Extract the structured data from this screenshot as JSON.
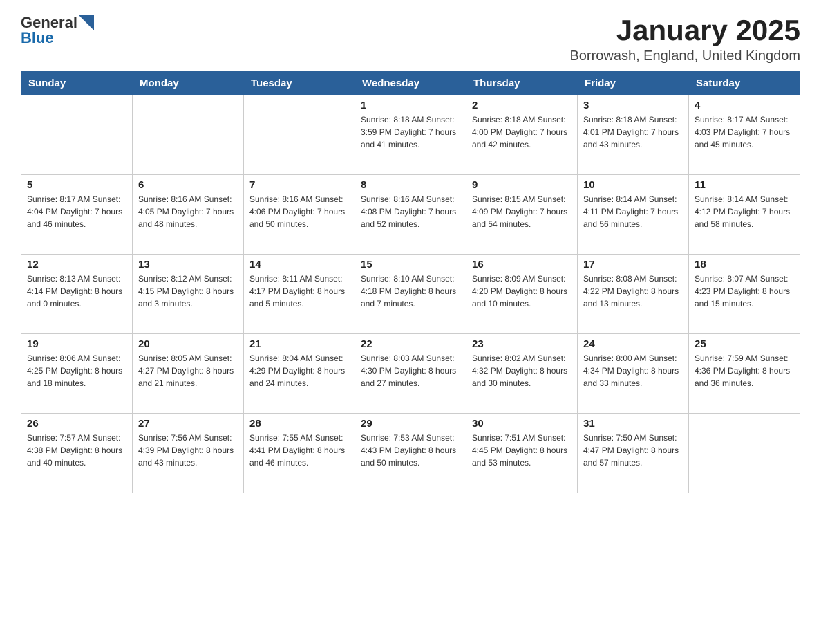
{
  "header": {
    "logo_general": "General",
    "logo_blue": "Blue",
    "title": "January 2025",
    "location": "Borrowash, England, United Kingdom"
  },
  "days_of_week": [
    "Sunday",
    "Monday",
    "Tuesday",
    "Wednesday",
    "Thursday",
    "Friday",
    "Saturday"
  ],
  "weeks": [
    [
      {
        "day": "",
        "info": ""
      },
      {
        "day": "",
        "info": ""
      },
      {
        "day": "",
        "info": ""
      },
      {
        "day": "1",
        "info": "Sunrise: 8:18 AM\nSunset: 3:59 PM\nDaylight: 7 hours\nand 41 minutes."
      },
      {
        "day": "2",
        "info": "Sunrise: 8:18 AM\nSunset: 4:00 PM\nDaylight: 7 hours\nand 42 minutes."
      },
      {
        "day": "3",
        "info": "Sunrise: 8:18 AM\nSunset: 4:01 PM\nDaylight: 7 hours\nand 43 minutes."
      },
      {
        "day": "4",
        "info": "Sunrise: 8:17 AM\nSunset: 4:03 PM\nDaylight: 7 hours\nand 45 minutes."
      }
    ],
    [
      {
        "day": "5",
        "info": "Sunrise: 8:17 AM\nSunset: 4:04 PM\nDaylight: 7 hours\nand 46 minutes."
      },
      {
        "day": "6",
        "info": "Sunrise: 8:16 AM\nSunset: 4:05 PM\nDaylight: 7 hours\nand 48 minutes."
      },
      {
        "day": "7",
        "info": "Sunrise: 8:16 AM\nSunset: 4:06 PM\nDaylight: 7 hours\nand 50 minutes."
      },
      {
        "day": "8",
        "info": "Sunrise: 8:16 AM\nSunset: 4:08 PM\nDaylight: 7 hours\nand 52 minutes."
      },
      {
        "day": "9",
        "info": "Sunrise: 8:15 AM\nSunset: 4:09 PM\nDaylight: 7 hours\nand 54 minutes."
      },
      {
        "day": "10",
        "info": "Sunrise: 8:14 AM\nSunset: 4:11 PM\nDaylight: 7 hours\nand 56 minutes."
      },
      {
        "day": "11",
        "info": "Sunrise: 8:14 AM\nSunset: 4:12 PM\nDaylight: 7 hours\nand 58 minutes."
      }
    ],
    [
      {
        "day": "12",
        "info": "Sunrise: 8:13 AM\nSunset: 4:14 PM\nDaylight: 8 hours\nand 0 minutes."
      },
      {
        "day": "13",
        "info": "Sunrise: 8:12 AM\nSunset: 4:15 PM\nDaylight: 8 hours\nand 3 minutes."
      },
      {
        "day": "14",
        "info": "Sunrise: 8:11 AM\nSunset: 4:17 PM\nDaylight: 8 hours\nand 5 minutes."
      },
      {
        "day": "15",
        "info": "Sunrise: 8:10 AM\nSunset: 4:18 PM\nDaylight: 8 hours\nand 7 minutes."
      },
      {
        "day": "16",
        "info": "Sunrise: 8:09 AM\nSunset: 4:20 PM\nDaylight: 8 hours\nand 10 minutes."
      },
      {
        "day": "17",
        "info": "Sunrise: 8:08 AM\nSunset: 4:22 PM\nDaylight: 8 hours\nand 13 minutes."
      },
      {
        "day": "18",
        "info": "Sunrise: 8:07 AM\nSunset: 4:23 PM\nDaylight: 8 hours\nand 15 minutes."
      }
    ],
    [
      {
        "day": "19",
        "info": "Sunrise: 8:06 AM\nSunset: 4:25 PM\nDaylight: 8 hours\nand 18 minutes."
      },
      {
        "day": "20",
        "info": "Sunrise: 8:05 AM\nSunset: 4:27 PM\nDaylight: 8 hours\nand 21 minutes."
      },
      {
        "day": "21",
        "info": "Sunrise: 8:04 AM\nSunset: 4:29 PM\nDaylight: 8 hours\nand 24 minutes."
      },
      {
        "day": "22",
        "info": "Sunrise: 8:03 AM\nSunset: 4:30 PM\nDaylight: 8 hours\nand 27 minutes."
      },
      {
        "day": "23",
        "info": "Sunrise: 8:02 AM\nSunset: 4:32 PM\nDaylight: 8 hours\nand 30 minutes."
      },
      {
        "day": "24",
        "info": "Sunrise: 8:00 AM\nSunset: 4:34 PM\nDaylight: 8 hours\nand 33 minutes."
      },
      {
        "day": "25",
        "info": "Sunrise: 7:59 AM\nSunset: 4:36 PM\nDaylight: 8 hours\nand 36 minutes."
      }
    ],
    [
      {
        "day": "26",
        "info": "Sunrise: 7:57 AM\nSunset: 4:38 PM\nDaylight: 8 hours\nand 40 minutes."
      },
      {
        "day": "27",
        "info": "Sunrise: 7:56 AM\nSunset: 4:39 PM\nDaylight: 8 hours\nand 43 minutes."
      },
      {
        "day": "28",
        "info": "Sunrise: 7:55 AM\nSunset: 4:41 PM\nDaylight: 8 hours\nand 46 minutes."
      },
      {
        "day": "29",
        "info": "Sunrise: 7:53 AM\nSunset: 4:43 PM\nDaylight: 8 hours\nand 50 minutes."
      },
      {
        "day": "30",
        "info": "Sunrise: 7:51 AM\nSunset: 4:45 PM\nDaylight: 8 hours\nand 53 minutes."
      },
      {
        "day": "31",
        "info": "Sunrise: 7:50 AM\nSunset: 4:47 PM\nDaylight: 8 hours\nand 57 minutes."
      },
      {
        "day": "",
        "info": ""
      }
    ]
  ]
}
